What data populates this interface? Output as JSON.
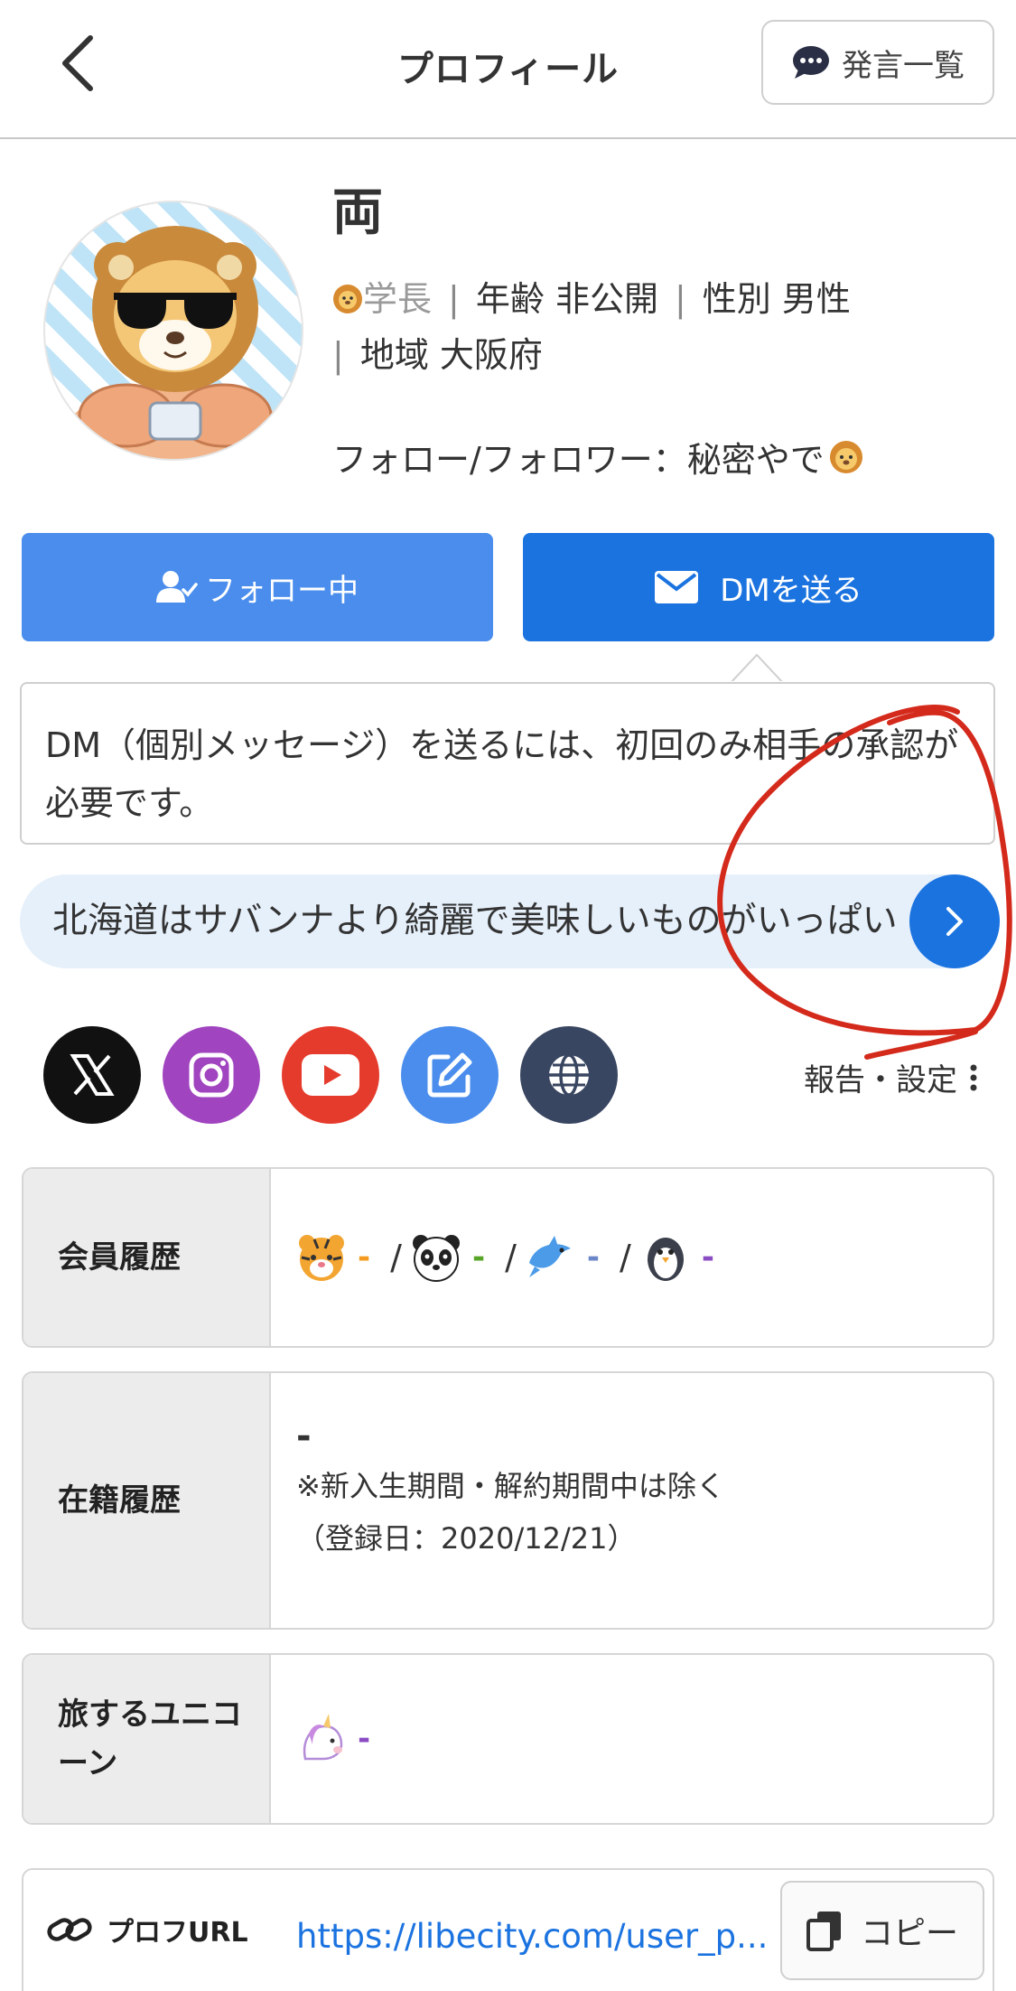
{
  "header": {
    "title": "プロフィール",
    "posts_button_label": "発言一覧"
  },
  "profile": {
    "name": "両",
    "rank": "学長",
    "age_label": "年齢",
    "age_value": "非公開",
    "gender_label": "性別",
    "gender_value": "男性",
    "region_label": "地域",
    "region_value": "大阪府",
    "follow_info": "フォロー/フォロワー：秘密やで"
  },
  "actions": {
    "follow_label": "フォロー中",
    "dm_label": "DMを送る"
  },
  "dm_note": "DM（個別メッセージ）を送るには、初回のみ相手の承認が必要です。",
  "bio": "北海道はサバンナより綺麗で美味しいものがいっぱい",
  "social_icons": [
    "x-icon",
    "instagram-icon",
    "youtube-icon",
    "note-icon",
    "website-icon"
  ],
  "report_label": "報告・設定",
  "info": {
    "membership_label": "会員履歴",
    "membership_items": [
      "-",
      "-",
      "-",
      "-"
    ],
    "history_label": "在籍履歴",
    "history_value": "-",
    "history_note": "※新入生期間・解約期間中は除く",
    "history_registered": "（登録日：2020/12/21）",
    "unicorn_label": "旅するユニコーン",
    "unicorn_value": "-"
  },
  "url": {
    "label": "プロフURL",
    "value": "https://libecity.com/user_p...",
    "copy_label": "コピー"
  },
  "colors": {
    "primary": "#1b73e0",
    "follow_button": "#4a8ded",
    "bio_background": "#e6f0fb",
    "annotation": "#d42a1c"
  }
}
